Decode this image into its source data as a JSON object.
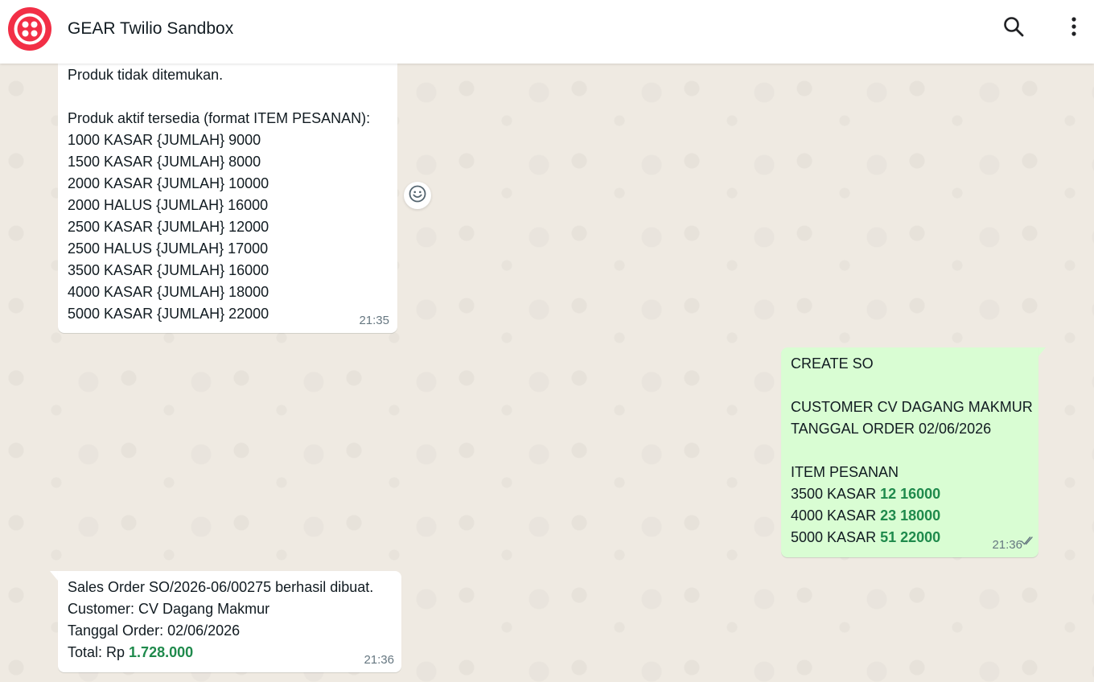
{
  "header": {
    "title": "GEAR Twilio Sandbox",
    "logo_color": "#f22f46"
  },
  "messages": [
    {
      "direction": "incoming",
      "lines": [
        "Produk tidak ditemukan.",
        "",
        "Produk aktif tersedia (format ITEM PESANAN):",
        "1000 KASAR {JUMLAH} 9000",
        "1500 KASAR {JUMLAH} 8000",
        "2000 KASAR {JUMLAH} 10000",
        "2000 HALUS {JUMLAH} 16000",
        "2500 KASAR {JUMLAH} 12000",
        "2500 HALUS {JUMLAH} 17000",
        "3500 KASAR {JUMLAH} 16000",
        "4000 KASAR {JUMLAH} 18000",
        "5000 KASAR {JUMLAH} 22000"
      ],
      "time": "21:35"
    },
    {
      "direction": "outgoing",
      "lines": [
        "CREATE SO",
        "",
        "CUSTOMER CV DAGANG MAKMUR",
        "TANGGAL ORDER 02/06/2026",
        "",
        "ITEM PESANAN"
      ],
      "items": [
        {
          "text": "3500 KASAR ",
          "qty_price": "12 16000"
        },
        {
          "text": "4000 KASAR ",
          "qty_price": "23 18000"
        },
        {
          "text": "5000 KASAR ",
          "qty_price": "51 22000"
        }
      ],
      "time": "21:36",
      "status": "read"
    },
    {
      "direction": "incoming",
      "lines": [
        "Sales Order SO/2026-06/00275 berhasil dibuat.",
        "Customer: CV Dagang Makmur",
        "Tanggal Order: 02/06/2026"
      ],
      "total_label": "Total: Rp ",
      "total_value": "1.728.000",
      "time": "21:36"
    }
  ],
  "colors": {
    "incoming_bg": "#ffffff",
    "outgoing_bg": "#d9fdd3",
    "chat_bg": "#efeae2",
    "highlight": "#1f8a4c"
  }
}
